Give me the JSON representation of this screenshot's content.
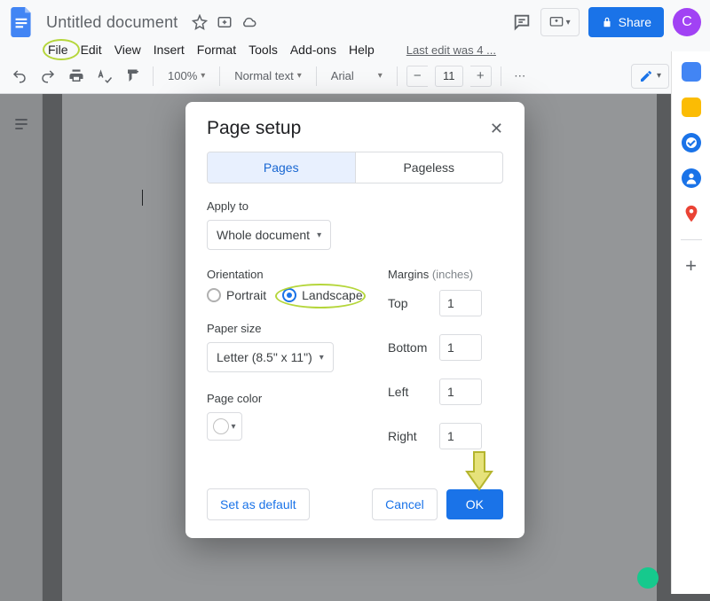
{
  "header": {
    "doc_title": "Untitled document",
    "share_label": "Share",
    "avatar_initial": "C",
    "last_edit_text": "Last edit was 4 ..."
  },
  "menu": {
    "items": [
      "File",
      "Edit",
      "View",
      "Insert",
      "Format",
      "Tools",
      "Add-ons",
      "Help"
    ]
  },
  "toolbar": {
    "zoom": "100%",
    "style": "Normal text",
    "font": "Arial",
    "font_size": "11"
  },
  "dialog": {
    "title": "Page setup",
    "tabs": {
      "pages": "Pages",
      "pageless": "Pageless"
    },
    "apply_label": "Apply to",
    "apply_value": "Whole document",
    "orientation_label": "Orientation",
    "portrait": "Portrait",
    "landscape": "Landscape",
    "paper_label": "Paper size",
    "paper_value": "Letter (8.5\" x 11\")",
    "page_color_label": "Page color",
    "margins_label": "Margins",
    "margins_unit": "(inches)",
    "top": "Top",
    "bottom": "Bottom",
    "left": "Left",
    "right": "Right",
    "mtop": "1",
    "mbottom": "1",
    "mleft": "1",
    "mright": "1",
    "set_default": "Set as default",
    "cancel": "Cancel",
    "ok": "OK"
  }
}
